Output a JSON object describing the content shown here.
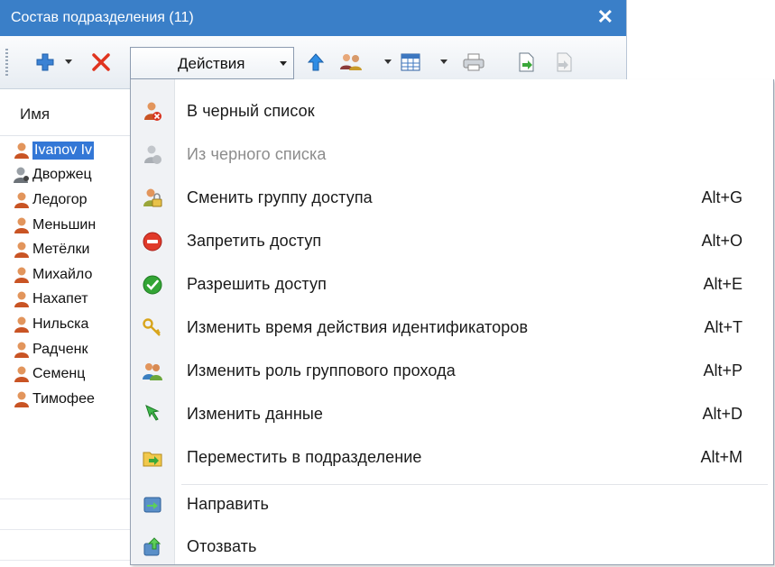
{
  "window": {
    "title": "Состав подразделения (11)",
    "close_glyph": "✕"
  },
  "toolbar": {
    "actions_label": "Действия",
    "icons": [
      "add-user-icon",
      "delete-icon",
      "checklist-icon",
      "arrow-up-icon",
      "group-users-icon",
      "grid-icon",
      "printer-icon",
      "export-icon",
      "import-icon"
    ]
  },
  "list": {
    "header": "Имя",
    "rows": [
      {
        "name": "Ivanov Iv",
        "selected": true,
        "icon": "user-icon"
      },
      {
        "name": "Дворжец",
        "selected": false,
        "icon": "user-blacklisted-icon"
      },
      {
        "name": "Ледогор",
        "selected": false,
        "icon": "user-icon"
      },
      {
        "name": "Меньшин",
        "selected": false,
        "icon": "user-icon"
      },
      {
        "name": "Метёлки",
        "selected": false,
        "icon": "user-icon"
      },
      {
        "name": "Михайло",
        "selected": false,
        "icon": "user-icon"
      },
      {
        "name": "Нахапет",
        "selected": false,
        "icon": "user-icon"
      },
      {
        "name": "Нильска",
        "selected": false,
        "icon": "user-icon"
      },
      {
        "name": "Радченк",
        "selected": false,
        "icon": "user-icon"
      },
      {
        "name": "Семенц",
        "selected": false,
        "icon": "user-icon"
      },
      {
        "name": "Тимофее",
        "selected": false,
        "icon": "user-icon"
      }
    ]
  },
  "menu": {
    "items": [
      {
        "label": "В черный список",
        "shortcut": "",
        "enabled": true,
        "icon": "blacklist-add-icon"
      },
      {
        "label": "Из черного списка",
        "shortcut": "",
        "enabled": false,
        "icon": "blacklist-remove-icon"
      },
      {
        "label": "Сменить группу доступа",
        "shortcut": "Alt+G",
        "enabled": true,
        "icon": "access-group-icon"
      },
      {
        "label": "Запретить доступ",
        "shortcut": "Alt+O",
        "enabled": true,
        "icon": "deny-access-icon"
      },
      {
        "label": "Разрешить доступ",
        "shortcut": "Alt+E",
        "enabled": true,
        "icon": "allow-access-icon"
      },
      {
        "label": "Изменить время действия идентификаторов",
        "shortcut": "Alt+T",
        "enabled": true,
        "icon": "keys-icon"
      },
      {
        "label": "Изменить роль группового прохода",
        "shortcut": "Alt+P",
        "enabled": true,
        "icon": "group-role-icon"
      },
      {
        "label": "Изменить данные",
        "shortcut": "Alt+D",
        "enabled": true,
        "icon": "edit-data-icon"
      },
      {
        "label": "Переместить в подразделение",
        "shortcut": "Alt+M",
        "enabled": true,
        "icon": "move-folder-icon"
      },
      {
        "label": "Направить",
        "shortcut": "",
        "enabled": true,
        "icon": "send-icon"
      },
      {
        "label": "Отозвать",
        "shortcut": "",
        "enabled": true,
        "icon": "recall-icon"
      }
    ]
  },
  "colors": {
    "titlebar": "#3a7fc8",
    "selection": "#3377d6",
    "menu_gutter": "#f0f2f5",
    "disabled_text": "#8c8c8c"
  }
}
